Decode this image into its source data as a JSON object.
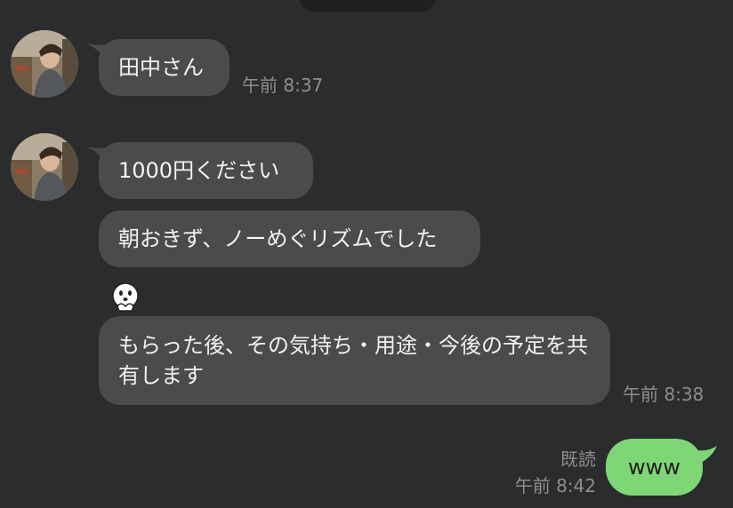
{
  "messages": [
    {
      "text": "田中さん",
      "time": "午前 8:37"
    },
    {
      "text": "1000円ください"
    },
    {
      "text": "朝おきず、ノーめぐリズムでした"
    },
    {
      "text": "もらった後、その気持ち・用途・今後の予定を共有します",
      "time": "午前 8:38"
    }
  ],
  "outgoing": {
    "text": "www",
    "read_label": "既読",
    "time": "午前 8:42"
  },
  "icons": {
    "avatar": "avatar-photo",
    "emoticon": "line-moon-emoticon-icon"
  },
  "colors": {
    "background": "#2b2c2e",
    "incoming_bubble": "#4b4b4d",
    "outgoing_bubble": "#7ed676",
    "timestamp": "#8e8e90"
  }
}
